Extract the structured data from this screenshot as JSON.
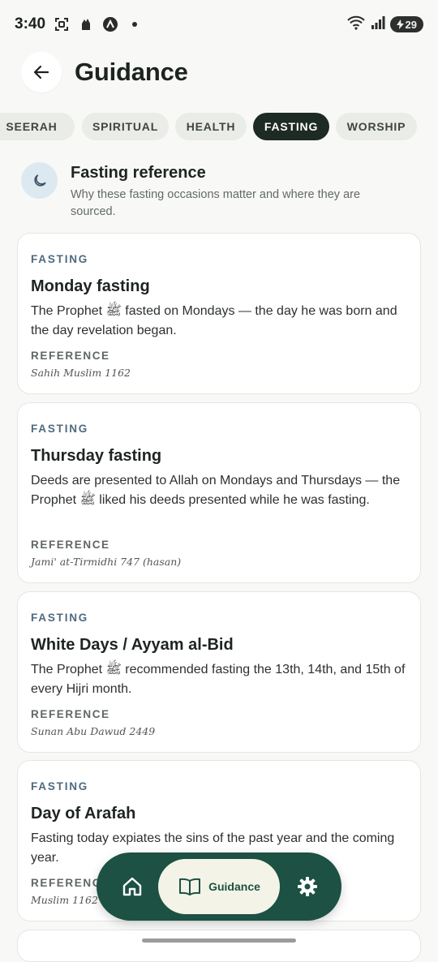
{
  "status": {
    "time": "3:40",
    "battery": "29"
  },
  "header": {
    "title": "Guidance"
  },
  "chips": [
    {
      "label": "SEERAH",
      "active": false
    },
    {
      "label": "SPIRITUAL",
      "active": false
    },
    {
      "label": "HEALTH",
      "active": false
    },
    {
      "label": "FASTING",
      "active": true
    },
    {
      "label": "WORSHIP",
      "active": false
    }
  ],
  "section": {
    "title": "Fasting reference",
    "subtitle": "Why these fasting occasions matter and where they are sourced."
  },
  "cards": [
    {
      "category": "FASTING",
      "title": "Monday fasting",
      "desc": "The Prophet ﷺ fasted on Mondays — the day he was born and the day revelation began.",
      "ref_label": "REFERENCE",
      "ref": "Sahih Muslim 1162"
    },
    {
      "category": "FASTING",
      "title": "Thursday fasting",
      "desc": "Deeds are presented to Allah on Mondays and Thursdays — the Prophet ﷺ liked his deeds presented while he was fasting.",
      "ref_label": "REFERENCE",
      "ref": "Jami' at-Tirmidhi 747 (hasan)"
    },
    {
      "category": "FASTING",
      "title": "White Days / Ayyam al-Bid",
      "desc": "The Prophet ﷺ recommended fasting the 13th, 14th, and 15th of every Hijri month.",
      "ref_label": "REFERENCE",
      "ref": "Sunan Abu Dawud 2449"
    },
    {
      "category": "FASTING",
      "title": "Day of Arafah",
      "desc": "Fasting today expiates the sins of the past year and the coming year.",
      "ref_label": "REFERENCE",
      "ref": "Muslim 1162"
    }
  ],
  "nav": {
    "guidance_label": "Guidance"
  },
  "icons": {
    "back": "arrow-left-icon",
    "section": "moon-icon",
    "home": "home-icon",
    "guidance": "book-icon",
    "settings": "gear-icon"
  },
  "colors": {
    "nav_bg": "#1c5143",
    "active_chip": "#1e2a24",
    "category": "#4e6a7f"
  }
}
